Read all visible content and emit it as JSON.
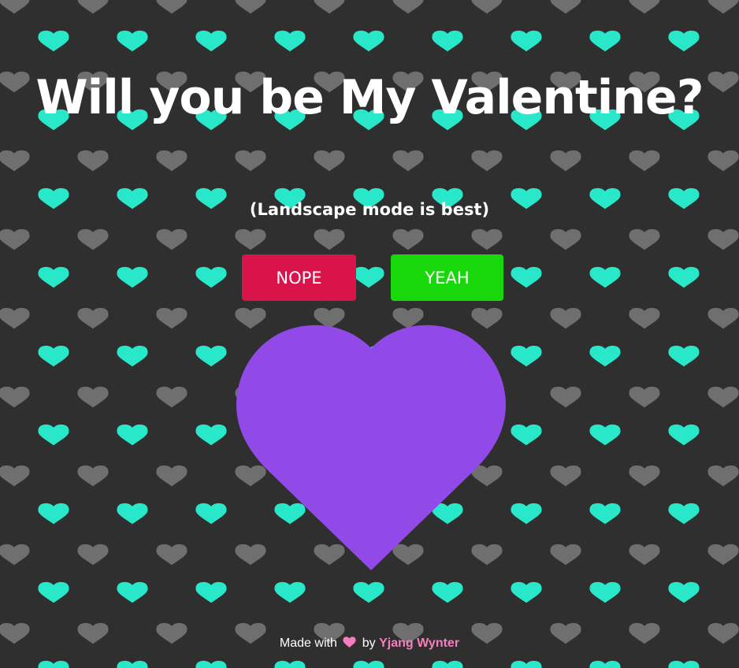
{
  "page": {
    "title": "Will you be My Valentine?",
    "subtitle": "(Landscape mode is best)"
  },
  "buttons": {
    "nope_label": "NOPE",
    "yeah_label": "YEAH"
  },
  "footer": {
    "made_with": "Made with",
    "heart_icon": "heart-icon",
    "by": "by",
    "author": "Yjang Wynter"
  },
  "colors": {
    "background": "#2f2f2f",
    "pattern_heart_teal": "#29e8c9",
    "pattern_heart_gray": "#6f6f6f",
    "nope_button": "#d8144a",
    "yeah_button": "#18d80c",
    "big_heart": "#9149e8",
    "footer_heart": "#f57fbe",
    "author_link": "#f57fbe",
    "text": "#ffffff"
  }
}
